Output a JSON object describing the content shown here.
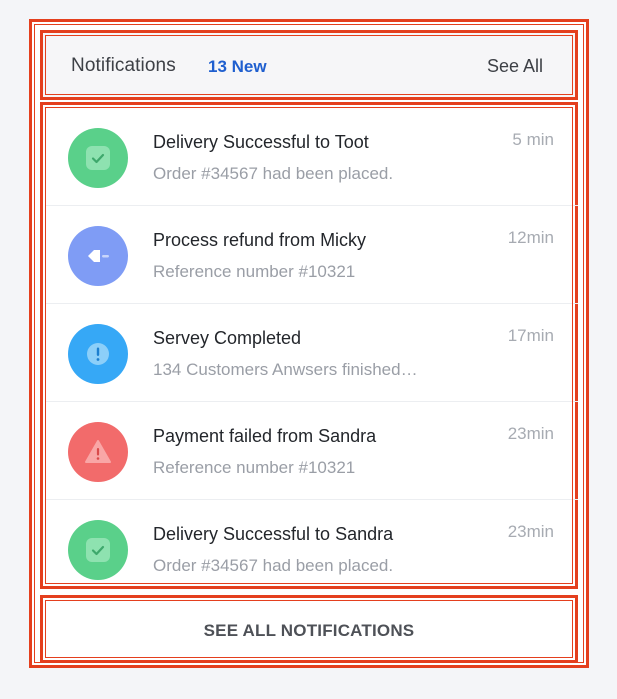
{
  "header": {
    "title": "Notifications",
    "badge": "13 New",
    "see_all": "See All"
  },
  "notifications": [
    {
      "title": "Delivery Successful to Toot",
      "subtitle": "Order #34567 had been placed.",
      "time": "5 min",
      "icon": "check-icon",
      "color": "#5ad08a"
    },
    {
      "title": "Process refund from Micky",
      "subtitle": "Reference number #10321",
      "time": "12min",
      "icon": "refund-tag-icon",
      "color": "#7f9cf5"
    },
    {
      "title": "Servey Completed",
      "subtitle": "134 Customers Anwsers finished…",
      "time": "17min",
      "icon": "info-icon",
      "color": "#36a8f6"
    },
    {
      "title": "Payment failed from Sandra",
      "subtitle": "Reference number #10321",
      "time": "23min",
      "icon": "warning-icon",
      "color": "#f26b6b"
    },
    {
      "title": "Delivery Successful to Sandra",
      "subtitle": "Order #34567 had been placed.",
      "time": "23min",
      "icon": "check-icon",
      "color": "#5ad08a"
    }
  ],
  "footer": {
    "label": "SEE ALL NOTIFICATIONS"
  }
}
